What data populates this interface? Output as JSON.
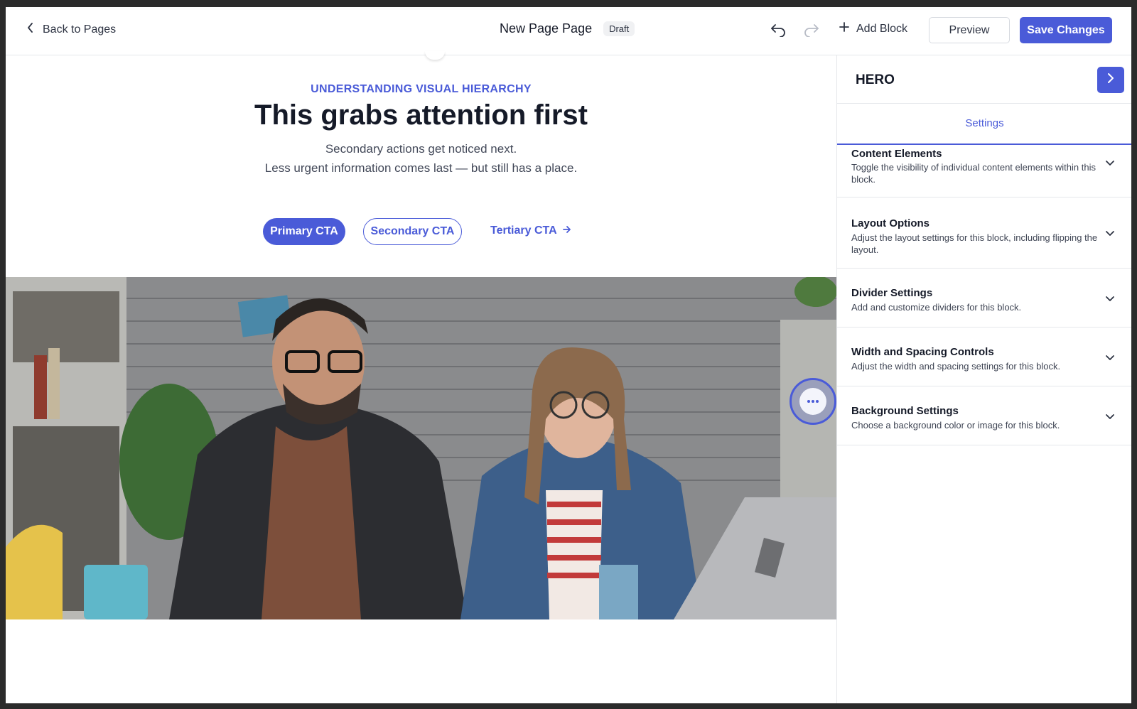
{
  "topbar": {
    "back_label": "Back to Pages",
    "page_title": "New Page Page",
    "status_badge": "Draft",
    "add_block_label": "Add Block",
    "preview_label": "Preview",
    "save_label": "Save Changes"
  },
  "hero": {
    "eyebrow": "UNDERSTANDING VISUAL HIERARCHY",
    "headline": "This grabs attention first",
    "subline_1": "Secondary actions get noticed next.",
    "subline_2": "Less urgent information comes last — but still has a place.",
    "cta_primary": "Primary CTA",
    "cta_secondary": "Secondary CTA",
    "cta_tertiary": "Tertiary CTA"
  },
  "sidebar": {
    "title": "HERO",
    "tab": "Settings",
    "panels": [
      {
        "title": "Content Elements",
        "desc": "Toggle the visibility of individual content elements within this block."
      },
      {
        "title": "Layout Options",
        "desc": "Adjust the layout settings for this block, including flipping the layout."
      },
      {
        "title": "Divider Settings",
        "desc": "Add and customize dividers for this block."
      },
      {
        "title": "Width and Spacing Controls",
        "desc": "Adjust the width and spacing settings for this block."
      },
      {
        "title": "Background Settings",
        "desc": "Choose a background color or image for this block."
      }
    ]
  },
  "icons": {
    "back": "chevron-left-icon",
    "undo": "undo-icon",
    "redo": "redo-icon",
    "add": "plus-icon",
    "tertiary_arrow": "arrow-right-icon",
    "collapse": "chevron-right-icon",
    "panel_toggle": "chevron-down-icon",
    "more": "more-horizontal-icon"
  },
  "colors": {
    "accent": "#4a5bd8",
    "text_dark": "#151a28",
    "frame_border": "#2b2b2b"
  }
}
